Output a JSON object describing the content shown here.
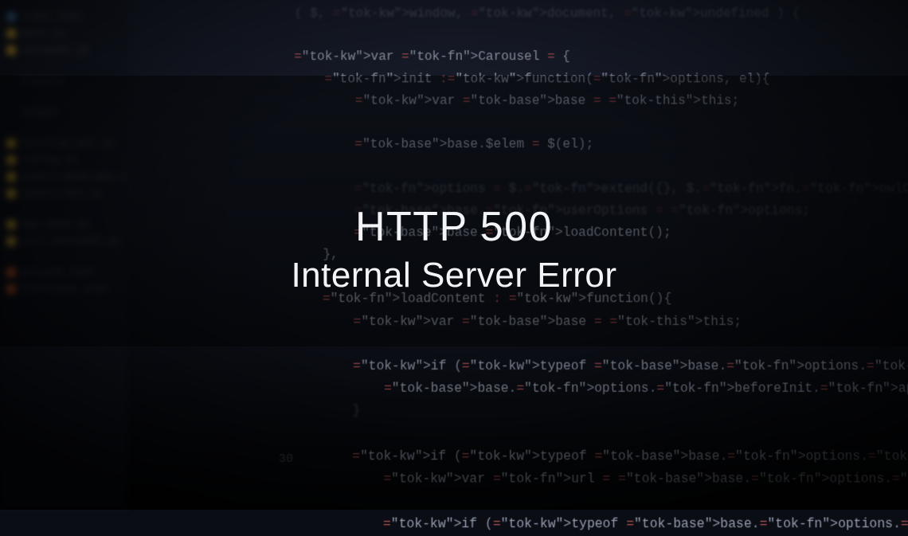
{
  "overlay": {
    "code": "HTTP 500",
    "message": "Internal Server Error"
  },
  "sidebar": {
    "items": [
      {
        "label": "index.html",
        "color": "#4a7fb5"
      },
      {
        "label": "main.js",
        "color": "#c9a235"
      },
      {
        "label": "carousel.js",
        "color": "#c9a235"
      },
      {
        "label": " ",
        "color": "transparent"
      },
      {
        "label": "Plugins",
        "color": "transparent"
      },
      {
        "label": " ",
        "color": "transparent"
      },
      {
        "label": "images",
        "color": "transparent"
      },
      {
        "label": " ",
        "color": "transparent"
      },
      {
        "label": "function.min.js",
        "color": "#c9a235"
      },
      {
        "label": "config.js",
        "color": "#c9a235"
      },
      {
        "label": "jquery.base.min.js",
        "color": "#c9a235"
      },
      {
        "label": "jquery.min.js",
        "color": "#c9a235"
      },
      {
        "label": " ",
        "color": "transparent"
      },
      {
        "label": "app.base.js",
        "color": "#c9a235"
      },
      {
        "label": "util.carousel.js",
        "color": "#c9a235"
      },
      {
        "label": " ",
        "color": "transparent"
      },
      {
        "label": "account.html",
        "color": "#d06030"
      },
      {
        "label": "functions.init",
        "color": "#d06030"
      }
    ]
  },
  "code": {
    "line_number": "30",
    "lines": [
      "( $, window, document, undefined ) {",
      "",
      "var Carousel = {",
      "    init :function(options, el){",
      "        var base = this;",
      "",
      "        base.$elem = $(el);",
      "",
      "        options = $.extend({}, $.fn.owlCarousel.options, base.$elem.data(), options);",
      "        base.userOptions = options;",
      "        base.loadContent();",
      "    },",
      "",
      "    loadContent : function(){",
      "        var base = this;",
      "",
      "        if (typeof base.options.beforeInit === \"function\") {",
      "            base.options.beforeInit.apply(this,[base.$elem]);",
      "        }",
      "",
      "        if (typeof base.options.jsonPath === \"string\") {",
      "            var url = base.options.jsonPath;",
      "",
      "            if (typeof base.options.jsonSuccess === \"function\") {"
    ]
  }
}
